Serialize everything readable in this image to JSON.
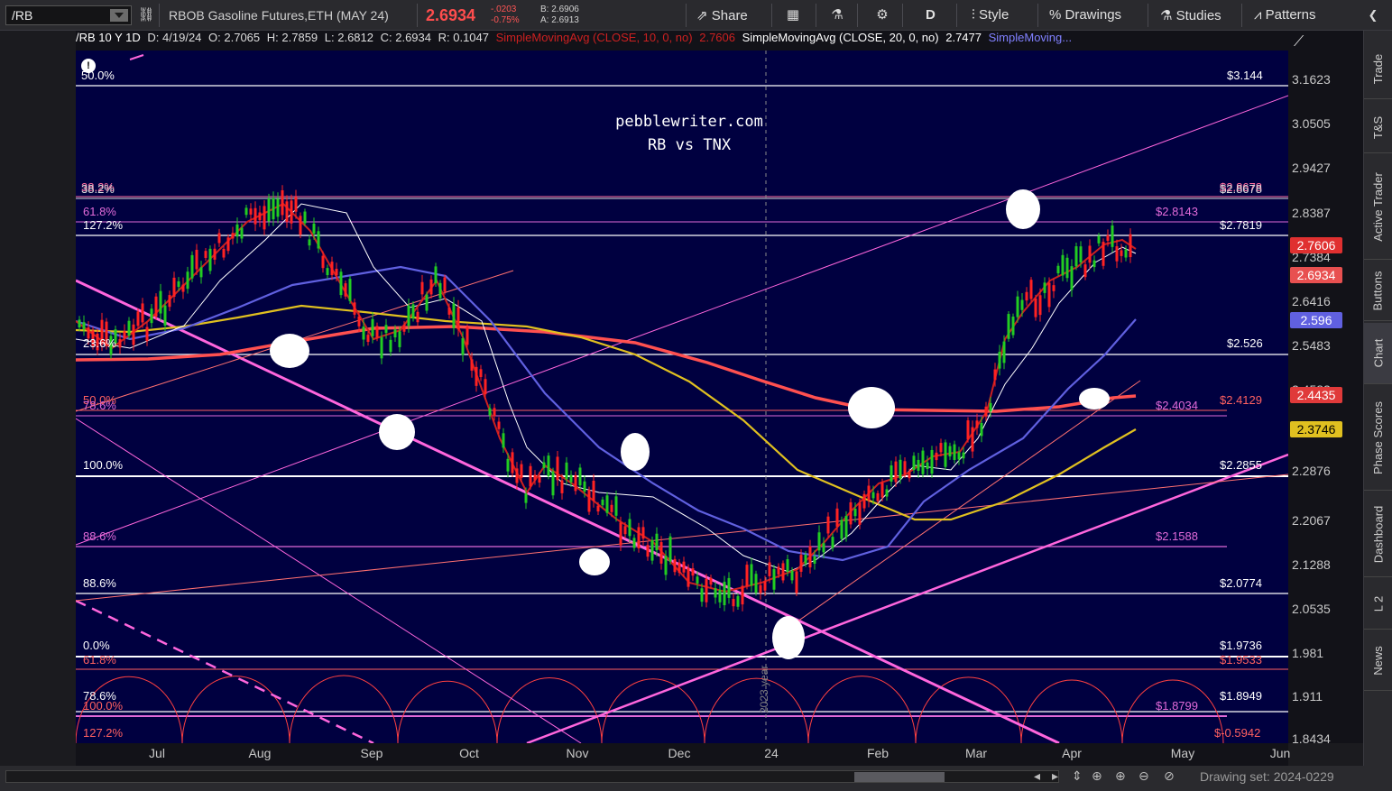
{
  "toolbar": {
    "symbol": "/RB",
    "description": "RBOB Gasoline Futures,ETH (MAY 24)",
    "last": "2.6934",
    "change": "-.0203",
    "change_pct": "-0.75%",
    "bid": "B: 2.6906",
    "ask": "A: 2.6913",
    "share": "Share",
    "period": "D",
    "style": "Style",
    "drawings": "Drawings",
    "studies": "Studies",
    "patterns": "Patterns"
  },
  "sidebar": [
    "Trade",
    "T&S",
    "Active Trader",
    "Buttons",
    "Chart",
    "Phase Scores",
    "Dashboard",
    "L 2",
    "News"
  ],
  "header": {
    "sym": "/RB 10 Y 1D",
    "date": "D: 4/19/24",
    "open": "O: 2.7065",
    "high": "H: 2.7859",
    "low": "L: 2.6812",
    "close": "C: 2.6934",
    "range": "R: 0.1047",
    "sma10_label": "SimpleMovingAvg (CLOSE, 10, 0, no)",
    "sma10_val": "2.7606",
    "sma20_label": "SimpleMovingAvg (CLOSE, 20, 0, no)",
    "sma20_val": "2.7477",
    "sma_more": "SimpleMoving..."
  },
  "watermark": {
    "line1": "pebblewriter.com",
    "line2": "RB vs TNX"
  },
  "fib_left": [
    {
      "t": "50.0%",
      "c": "#ffffff"
    },
    {
      "t": "38.2%",
      "c": "#ff6fa0"
    },
    {
      "t": "38.2%",
      "c": "#dddddd"
    },
    {
      "t": "61.8%",
      "c": "#e06ad8"
    },
    {
      "t": "127.2%",
      "c": "#ffffff"
    },
    {
      "t": "23.6%",
      "c": "#ffffff"
    },
    {
      "t": "50.0%",
      "c": "#ff6060"
    },
    {
      "t": "78.6%",
      "c": "#e06ad8"
    },
    {
      "t": "100.0%",
      "c": "#ffffff"
    },
    {
      "t": "88.6%",
      "c": "#e06ad8"
    },
    {
      "t": "88.6%",
      "c": "#ffffff"
    },
    {
      "t": "0.0%",
      "c": "#ffffff"
    },
    {
      "t": "61.8%",
      "c": "#ff6060"
    },
    {
      "t": "78.6%",
      "c": "#ffffff"
    },
    {
      "t": "100.0%",
      "c": "#ff6060"
    },
    {
      "t": "127.2%",
      "c": "#ff6060"
    }
  ],
  "fib_right": [
    {
      "t": "$3.144",
      "c": "#ffffff"
    },
    {
      "t": "$2.8678",
      "c": "#ff6fa0"
    },
    {
      "t": "$2.8678",
      "c": "#dddddd"
    },
    {
      "t": "$2.8143",
      "c": "#e06ad8"
    },
    {
      "t": "$2.7819",
      "c": "#ffffff"
    },
    {
      "t": "$2.526",
      "c": "#ffffff"
    },
    {
      "t": "$2.4129",
      "c": "#ff6060"
    },
    {
      "t": "$2.4034",
      "c": "#e06ad8"
    },
    {
      "t": "$2.2855",
      "c": "#ffffff"
    },
    {
      "t": "$2.1588",
      "c": "#e06ad8"
    },
    {
      "t": "$2.0774",
      "c": "#ffffff"
    },
    {
      "t": "$1.9736",
      "c": "#ffffff"
    },
    {
      "t": "$1.9533",
      "c": "#ff6060"
    },
    {
      "t": "$1.8949",
      "c": "#ffffff"
    },
    {
      "t": "$1.8799",
      "c": "#e06ad8"
    },
    {
      "t": "$-0.5942",
      "c": "#ff6060"
    }
  ],
  "y_ticks": [
    "3.1623",
    "3.0505",
    "2.9427",
    "2.8387",
    "2.7384",
    "2.6416",
    "2.5483",
    "2.4582",
    "2.2876",
    "2.2067",
    "2.1288",
    "2.0535",
    "1.981",
    "1.911",
    "1.8434"
  ],
  "y_badges": [
    {
      "t": "2.7606",
      "bg": "#e03030",
      "fg": "#ffffff"
    },
    {
      "t": "2.6934",
      "bg": "#e85050",
      "fg": "#ffffff"
    },
    {
      "t": "2.596",
      "bg": "#6060e0",
      "fg": "#ffffff"
    },
    {
      "t": "2.4435",
      "bg": "#e03a3a",
      "fg": "#ffffff"
    },
    {
      "t": "2.3746",
      "bg": "#e0c020",
      "fg": "#000000"
    }
  ],
  "x_ticks": [
    "Jul",
    "Aug",
    "Sep",
    "Oct",
    "Nov",
    "Dec",
    "24",
    "Feb",
    "Mar",
    "Apr",
    "May",
    "Jun"
  ],
  "year_marker": "2023 year",
  "bottom": {
    "drawing_set": "Drawing set: 2024-0229"
  },
  "colors": {
    "background": "#000040",
    "price_up": "#22cc22",
    "price_down": "#ff2222",
    "sma10": "#cc2020",
    "sma20": "#ffffff",
    "sma50": "#6060e0",
    "sma100": "#e0c020",
    "sma200": "#ff5050",
    "trendline": "#ff66dd"
  }
}
